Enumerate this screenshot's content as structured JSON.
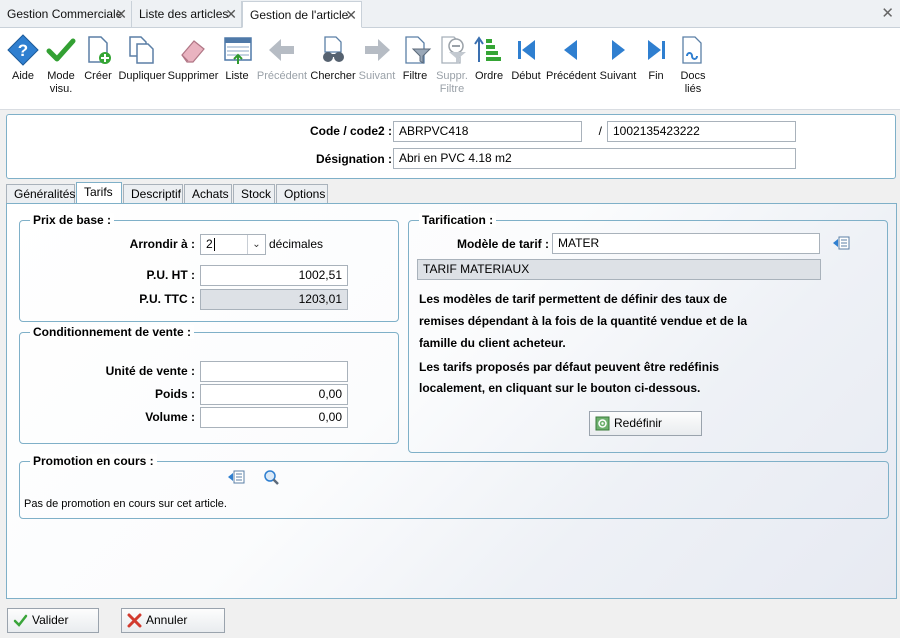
{
  "doc_tabs": [
    {
      "label": "Gestion Commerciale"
    },
    {
      "label": "Liste des articles"
    },
    {
      "label": "Gestion de l'article"
    }
  ],
  "toolbar": [
    {
      "label": "Aide",
      "icon": "help-icon"
    },
    {
      "label": "Mode visu.",
      "icon": "check-icon"
    },
    {
      "label": "Créer",
      "icon": "create-doc-icon"
    },
    {
      "label": "Dupliquer",
      "icon": "duplicate-icon"
    },
    {
      "label": "Supprimer",
      "icon": "eraser-icon"
    },
    {
      "label": "Liste",
      "icon": "list-icon"
    },
    {
      "label": "Précédent",
      "icon": "arrow-left-icon",
      "disabled": true
    },
    {
      "label": "Chercher",
      "icon": "binoculars-icon"
    },
    {
      "label": "Suivant",
      "icon": "arrow-right-icon",
      "disabled": true
    },
    {
      "label": "Filtre",
      "icon": "filter-icon"
    },
    {
      "label": "Suppr. Filtre",
      "icon": "remove-filter-icon",
      "disabled": true
    },
    {
      "label": "Ordre",
      "icon": "sort-icon"
    },
    {
      "label": "Début",
      "icon": "first-icon"
    },
    {
      "label": "Précédent",
      "icon": "previous-icon"
    },
    {
      "label": "Suivant",
      "icon": "next-icon"
    },
    {
      "label": "Fin",
      "icon": "last-icon"
    },
    {
      "label": "Docs liés",
      "icon": "linked-docs-icon"
    }
  ],
  "header": {
    "code_label": "Code / code2 :",
    "code_value": "ABRPVC418",
    "separator": "/",
    "code2_value": "1002135423222",
    "designation_label": "Désignation :",
    "designation_value": "Abri en PVC 4.18 m2"
  },
  "inner_tabs": [
    "Généralités",
    "Tarifs",
    "Descriptif",
    "Achats",
    "Stock",
    "Options"
  ],
  "prix_base": {
    "title": "Prix de base :",
    "arrondir_label": "Arrondir à :",
    "arrondir_value": "2",
    "decimales_label": "décimales",
    "pu_ht_label": "P.U. HT :",
    "pu_ht_value": "1002,51",
    "pu_ttc_label": "P.U. TTC :",
    "pu_ttc_value": "1203,01"
  },
  "conditionnement": {
    "title": "Conditionnement de vente :",
    "unite_label": "Unité de vente :",
    "unite_value": "",
    "poids_label": "Poids :",
    "poids_value": "0,00",
    "volume_label": "Volume :",
    "volume_value": "0,00"
  },
  "tarification": {
    "title": "Tarification :",
    "modele_label": "Modèle de tarif :",
    "modele_value": "MATER",
    "modele_desc": "TARIF MATERIAUX",
    "text1_line1": "Les modèles de tarif permettent de définir des taux de",
    "text1_line2": "remises dépendant à la fois de la quantité vendue et de la",
    "text1_line3": "famille du client acheteur.",
    "text2_line1": "Les tarifs proposés par défaut peuvent être redéfinis",
    "text2_line2": "localement, en cliquant sur le bouton ci-dessous.",
    "redefinir_label": "Redéfinir"
  },
  "promotion": {
    "title": "Promotion en cours :",
    "text": "Pas de promotion en cours sur cet article."
  },
  "footer": {
    "valider_label": "Valider",
    "annuler_label": "Annuler"
  },
  "colors": {
    "accent": "#1f74c6",
    "frame": "#7fb0c8",
    "valid_green": "#3aa53a",
    "cancel_red": "#d23b2f"
  }
}
